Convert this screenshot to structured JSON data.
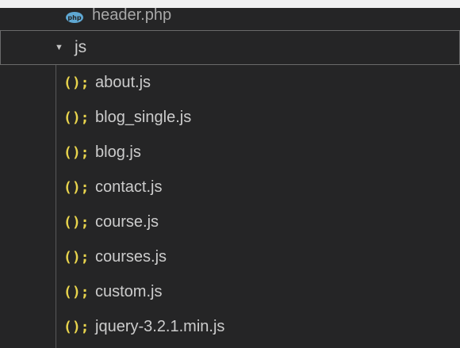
{
  "explorer": {
    "header_file": {
      "name": "header.php",
      "icon": "php-icon"
    },
    "folder": {
      "name": "js",
      "icon": "chevron-down-icon",
      "expanded": true
    },
    "files": [
      {
        "name": "about.js",
        "icon": "js-file-icon"
      },
      {
        "name": "blog_single.js",
        "icon": "js-file-icon"
      },
      {
        "name": "blog.js",
        "icon": "js-file-icon"
      },
      {
        "name": "contact.js",
        "icon": "js-file-icon"
      },
      {
        "name": "course.js",
        "icon": "js-file-icon"
      },
      {
        "name": "courses.js",
        "icon": "js-file-icon"
      },
      {
        "name": "custom.js",
        "icon": "js-file-icon"
      },
      {
        "name": "jquery-3.2.1.min.js",
        "icon": "js-file-icon"
      }
    ]
  },
  "colors": {
    "background": "#252526",
    "text": "#cccccc",
    "js_icon": "#e8d44d",
    "php_icon": "#5fa8d3",
    "selection_border": "#6a6a6a"
  }
}
